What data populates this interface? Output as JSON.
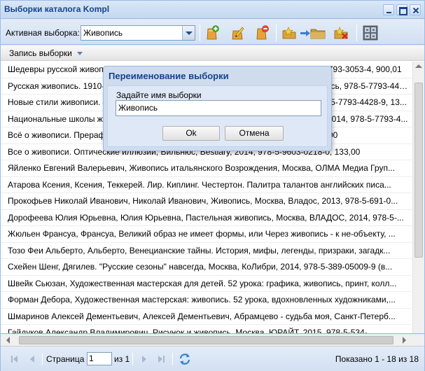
{
  "window": {
    "title": "Выборки каталога Kompl"
  },
  "toolbar": {
    "active_label": "Активная выборка:",
    "active_value": "Живопись"
  },
  "grid": {
    "column_header": "Запись выборки",
    "rows": [
      "Шедевры русской живописи. — М.: Белый город, Русская живопись, 2014, 978-5-7793-3053-4, 900,01",
      "Русская живопись. 1910-х годов, Живопись, Москва, Белый город, Русская живопись, 978-5-7793-4439-5, 1263...",
      "Новые стили живописи. — М.: Белый город, Русская живопись, Москва, 2014, 978-5-7793-4428-9, 13...",
      "Национальные школы живописи. — М.: Белый город, Русская живопись, Москва, 2014, 978-5-7793-4...",
      "Всё о живописи. Прерафаэлиты, Вильнюс, Bestiary, 2014, 978-5-9603-0219-5, 133,00",
      "Все о живописи. Оптические иллюзии, Вильнюс, Bestiary, 2014, 978-5-9603-0218-0, 133,00",
      "Яйленко Евгений Валерьевич, Живопись итальянского Возрождения, Москва, ОЛМА Медиа Груп...",
      "Атарова Ксения, Ксения, Теккерей. Лир. Киплинг. Честертон. Палитра талантов английских писа...",
      "Прокофьев Николай Иванович, Николай Иванович, Живопись, Москва, Владос, 2013, 978-5-691-0...",
      "Дорофеева Юлия Юрьевна, Юлия Юрьевна, Пастельная живопись, Москва, ВЛАДОС, 2014, 978-5-...",
      "Жюльен Франсуа, Франсуа, Великий образ не имеет формы, или Через живопись - к не-объекту, ...",
      "Тозо Феи Альберто, Альберто, Венецианские тайны. История, мифы, легенды, призраки, загадк...",
      "Схейен Шенг, Дягилев. \"Русские сезоны\" навсегда, Москва, КоЛибри, 2014, 978-5-389-05009-9 (в...",
      "Швейк Сьюзан, Художественная мастерская для детей. 52 урока: графика, живопись, принт, колл...",
      "Форман Дебора, Художественная мастерская: живопись. 52 урока, вдохновленных художниками,...",
      "Шмаринов Алексей Дементьевич, Алексей Дементьевич, Абрамцево - судьба моя, Санкт-Петерб...",
      "Гайдуков Александр Владимирович, Рисунок и живопись, Москва, ЮРАЙТ, 2015, 978-5-534-..."
    ]
  },
  "pager": {
    "page_label": "Страница",
    "page_value": "1",
    "of_label": "из 1",
    "status": "Показано 1 - 18 из 18"
  },
  "dialog": {
    "title": "Переименование выборки",
    "prompt": "Задайте имя выборки",
    "value": "Живопись",
    "ok_label": "Ok",
    "cancel_label": "Отмена"
  },
  "icons": {
    "add": "add-selection-icon",
    "edit": "edit-selection-icon",
    "delete": "delete-selection-icon",
    "star_folder": "star-folder-icon",
    "move": "move-to-folder-icon",
    "remove_star": "remove-star-icon",
    "settings": "grid-settings-icon",
    "refresh": "refresh-icon"
  }
}
